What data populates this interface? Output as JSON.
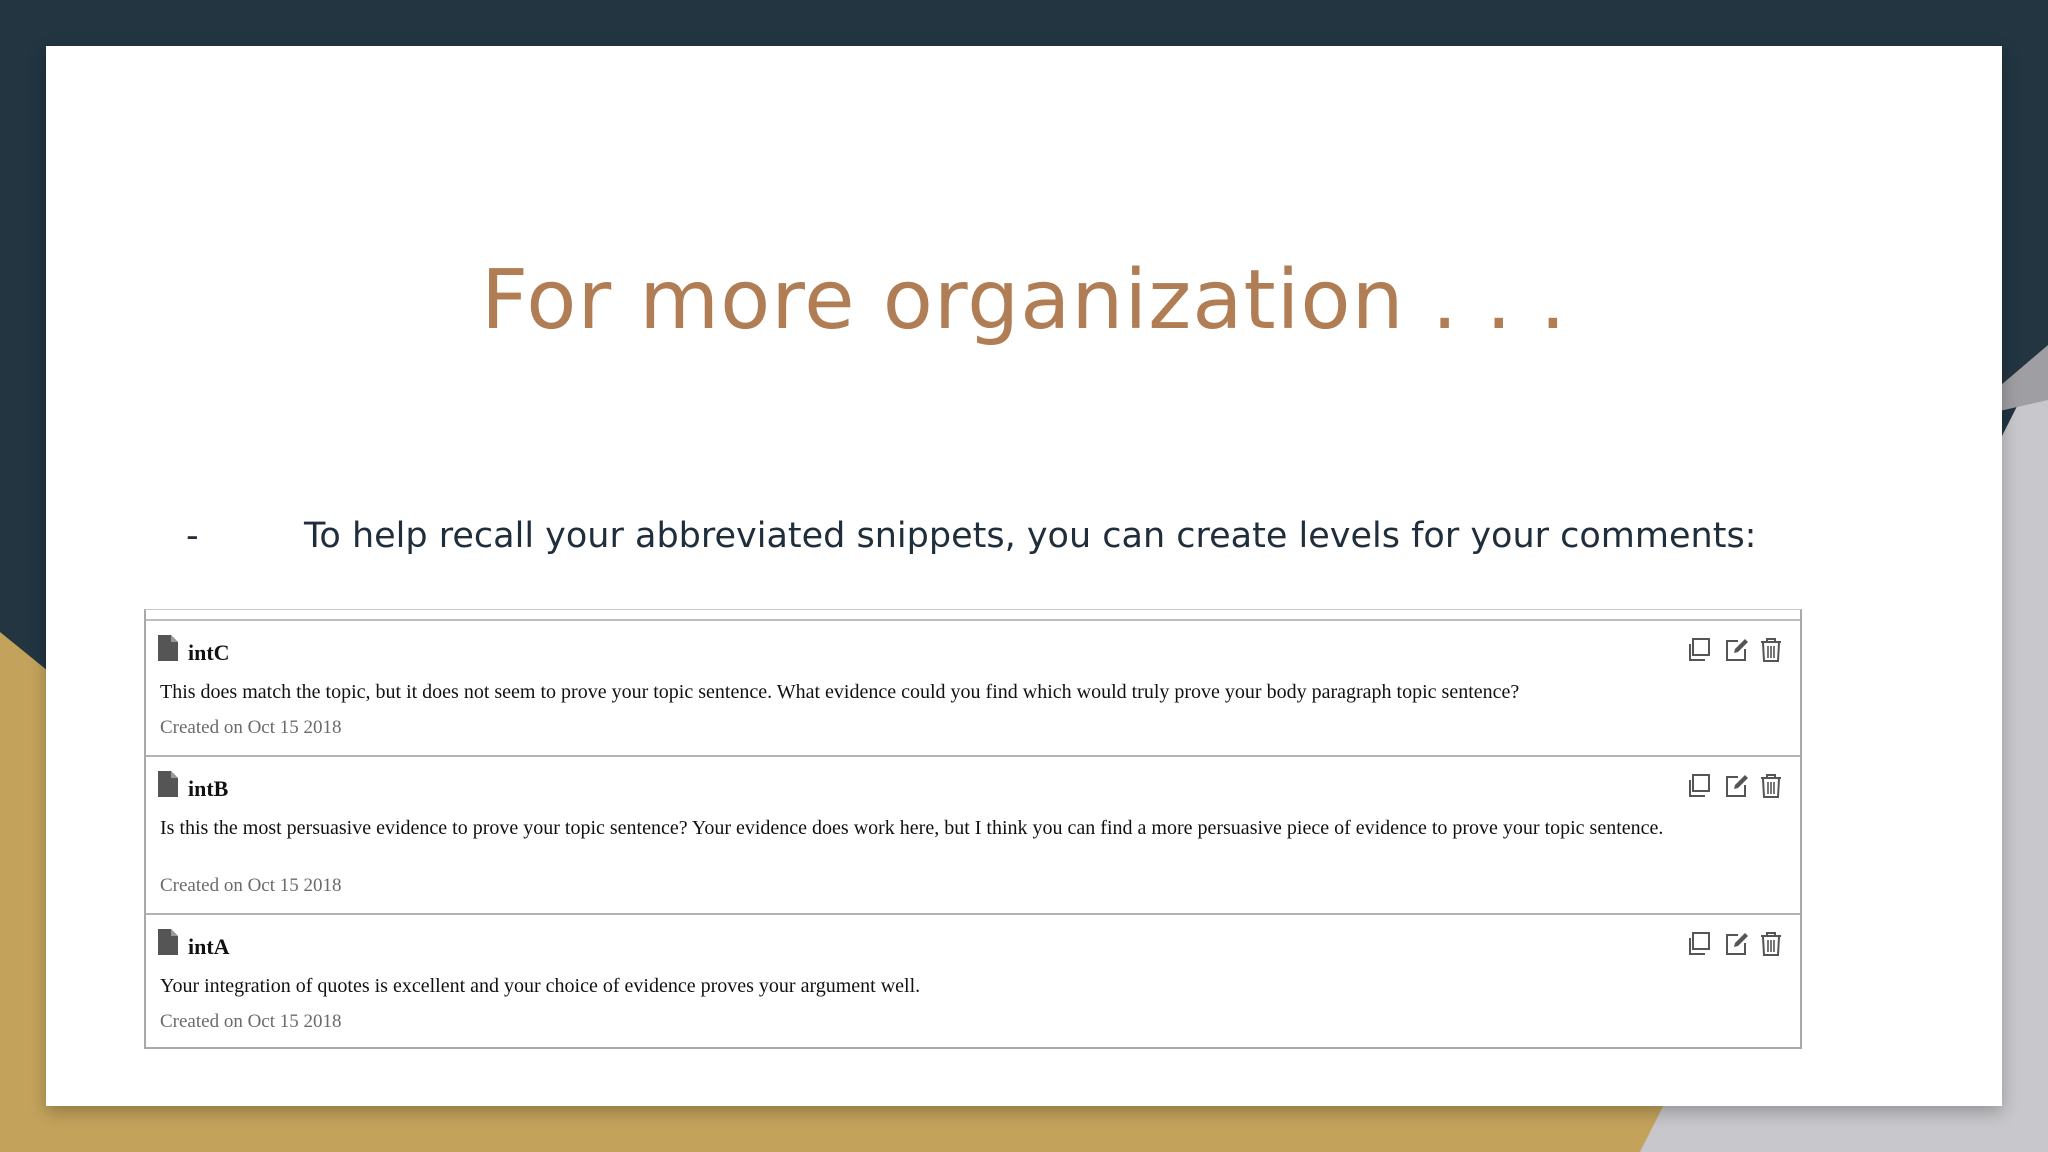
{
  "slide": {
    "title": "For more organization . . .",
    "bullet_marker": "-",
    "bullet_text": "To help recall your abbreviated snippets, you can create levels for your comments:"
  },
  "colors": {
    "title": "#b07d55",
    "dark_background": "#223540",
    "gold_accent": "#c3a35c",
    "gray_accent": "#c8c8cc"
  },
  "comments": [
    {
      "name": "intC",
      "body": "This does match the topic, but it does not seem to prove your topic sentence. What evidence could you find which would truly prove your body paragraph topic sentence?",
      "date": "Created on Oct 15 2018"
    },
    {
      "name": "intB",
      "body": "Is this the most persuasive evidence to prove your topic sentence? Your evidence does work here, but I think you can find a more persuasive piece of evidence to prove your topic sentence.",
      "date": "Created on Oct 15 2018"
    },
    {
      "name": "intA",
      "body": "Your integration of quotes is excellent and your choice of evidence proves your argument well.",
      "date": "Created on Oct 15 2018"
    }
  ],
  "icons": {
    "document": "document-icon",
    "copy": "copy-icon",
    "edit": "edit-icon",
    "delete": "trash-icon"
  }
}
